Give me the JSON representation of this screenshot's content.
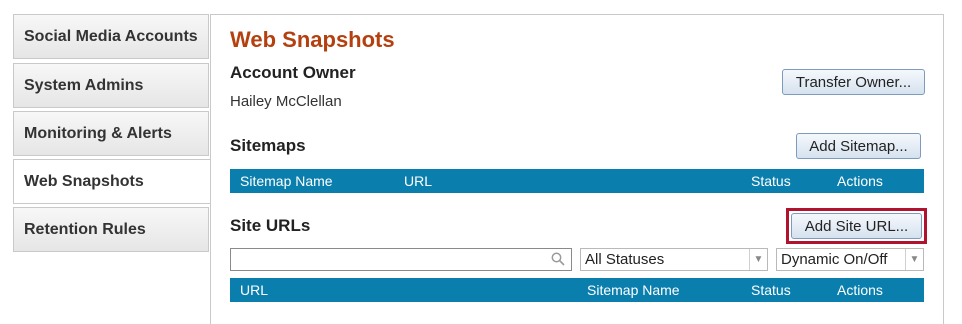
{
  "sidebar": {
    "items": [
      {
        "label": "Social Media Accounts"
      },
      {
        "label": "System Admins"
      },
      {
        "label": "Monitoring & Alerts"
      },
      {
        "label": "Web Snapshots"
      },
      {
        "label": "Retention Rules"
      }
    ],
    "active_index": 3
  },
  "main": {
    "title": "Web Snapshots",
    "account_owner": {
      "heading": "Account Owner",
      "name": "Hailey McClellan",
      "transfer_label": "Transfer Owner..."
    },
    "sitemaps": {
      "heading": "Sitemaps",
      "add_label": "Add Sitemap...",
      "columns": [
        "Sitemap Name",
        "URL",
        "Status",
        "Actions"
      ]
    },
    "site_urls": {
      "heading": "Site URLs",
      "add_label": "Add Site URL...",
      "search": {
        "value": "",
        "placeholder": ""
      },
      "status_filter": "All Statuses",
      "dynamic_filter": "Dynamic On/Off",
      "columns": [
        "URL",
        "Sitemap Name",
        "Status",
        "Actions"
      ]
    }
  },
  "colors": {
    "accent_title": "#b5400f",
    "table_header": "#0a7fad",
    "highlight_border": "#b0132e"
  }
}
